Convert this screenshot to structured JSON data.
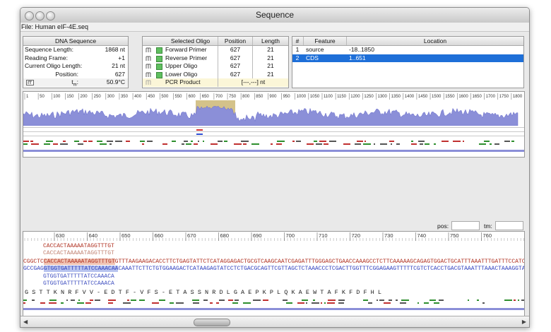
{
  "window": {
    "title": "Sequence",
    "file_label": "File: Human eIF-4E.seq"
  },
  "dna": {
    "header": "DNA Sequence",
    "rows": [
      {
        "label": "Sequence Length:",
        "value": "1868 nt"
      },
      {
        "label": "Reading Frame:",
        "value": "+1"
      },
      {
        "label": "Current Oligo Length:",
        "value": "21 nt"
      },
      {
        "label": "Position:",
        "value": "627"
      },
      {
        "label": "t",
        "sub": "m",
        "suffix": ":",
        "value": "50.9°C"
      }
    ]
  },
  "oligo": {
    "headers": [
      "Selected Oligo",
      "Position",
      "Length"
    ],
    "rows": [
      {
        "name": "Forward Primer",
        "pos": "627",
        "len": "21"
      },
      {
        "name": "Reverse Primer",
        "pos": "627",
        "len": "21"
      },
      {
        "name": "Upper Oligo",
        "pos": "627",
        "len": "21"
      },
      {
        "name": "Lower Oligo",
        "pos": "627",
        "len": "21"
      },
      {
        "name": "PCR Product",
        "pos": "[---,---] nt",
        "len": ""
      }
    ]
  },
  "features": {
    "headers": [
      "#",
      "Feature",
      "Location"
    ],
    "rows": [
      {
        "num": "1",
        "name": "source",
        "loc": "-18..1850"
      },
      {
        "num": "2",
        "name": "CDS",
        "loc": "1..651"
      }
    ]
  },
  "overview_ruler": [
    "1",
    "50",
    "100",
    "150",
    "200",
    "250",
    "300",
    "350",
    "400",
    "450",
    "500",
    "550",
    "600",
    "650",
    "700",
    "750",
    "800",
    "850",
    "900",
    "950",
    "1000",
    "1050",
    "1100",
    "1150",
    "1200",
    "1250",
    "1300",
    "1350",
    "1400",
    "1450",
    "1500",
    "1550",
    "1600",
    "1650",
    "1700",
    "1750",
    "1800"
  ],
  "pos_label": "pos:",
  "tm_label": "tm:",
  "detail_ruler": [
    "630",
    "640",
    "650",
    "660",
    "670",
    "680",
    "690",
    "700",
    "710",
    "720",
    "730",
    "740",
    "750",
    "760"
  ],
  "seq": {
    "fwd_primer": "CACCACTAAAAATAGGTTTGT",
    "fwd_primer2": "CACCACTAAAAATAGGTTTGT",
    "top_strand_pre": "CGGCTC",
    "top_strand_hl": "CACCACTAAAAATAGGTTTGT",
    "top_strand_post": "GTTTAAGAAGACACCTTCTGAGTATTCTCATAGGAGACTGCGTCAAGCAATCGAGATTTGGGAGCTGAACCAAAGCCTCTTCAAAAAGCAGAGTGGACTGCATTTAAATTTGATTTCCATCT",
    "bottom_strand_pre": "GCCGAG",
    "bottom_strand_hl": "GTGGTGATTTTTATCCAAACAA",
    "bottom_strand_post": "CAAATTCTTCTGTGGAAGACTCATAAGAGTATCCTCTGACGCAGTTCGTTAGCTCTAAACCCTCGACTTGGTTTCGGAGAAGTTTTTCGTCTCACCTGACGTAAATTTAAACTAAAGGTAGA",
    "rev_primer": "GTGGTGATTTTTATCCAAACA",
    "rev_primer2": "GTGGTGATTTTTATCCAAACA",
    "protein": "G  S  T  T  K  N  R  F  V  V  -  E  D  T  F  -  V  F  S  -  E  T  A  S  S  N  R  D  L  G  A  E  P  K  P  L  Q  K  A  E  W  T  A  F  K  F  D  F  H  L"
  },
  "colors": {
    "accent": "#1e6fd8",
    "plot": "#8b8fd8",
    "highlight": "#d4c28a"
  }
}
